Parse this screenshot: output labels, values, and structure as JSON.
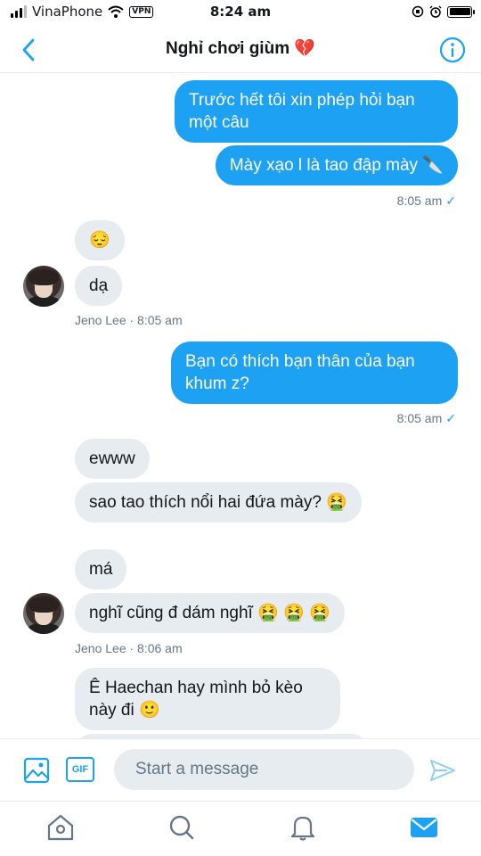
{
  "status_bar": {
    "carrier": "VinaPhone",
    "vpn": "VPN",
    "time": "8:24 am"
  },
  "header": {
    "title": "Nghỉ chơi giùm 💔"
  },
  "messages": [
    {
      "direction": "out",
      "text": "Trước hết tôi xin phép hỏi bạn một câu"
    },
    {
      "direction": "out",
      "text": "Mày xạo l là tao đập mày 🔪"
    },
    {
      "meta": "8:05 am",
      "check": "✓"
    },
    {
      "direction": "in",
      "text": "😔"
    },
    {
      "direction": "in",
      "text": "dạ"
    },
    {
      "meta": "Jeno Lee · 8:05 am"
    },
    {
      "direction": "out",
      "text": "Bạn có thích bạn thân của bạn khum z?"
    },
    {
      "meta": "8:05 am",
      "check": "✓"
    },
    {
      "direction": "in",
      "text": "ewww"
    },
    {
      "direction": "in",
      "text": "sao tao thích nổi hai đứa mày? 🤮"
    },
    {
      "direction": "in",
      "text": "má"
    },
    {
      "direction": "in",
      "text": "nghĩ cũng đ dám nghĩ 🤮 🤮 🤮"
    },
    {
      "meta": "Jeno Lee · 8:06 am"
    },
    {
      "direction": "in",
      "text": "Ê Haechan hay mình bỏ kèo này đi 🙂"
    }
  ],
  "composer": {
    "placeholder": "Start a message",
    "gif_label": "GIF"
  },
  "icons": {
    "back": "chevron-left-icon",
    "info": "info-icon",
    "image": "image-icon",
    "gif": "gif-icon",
    "send": "send-icon",
    "home": "home-icon",
    "search": "search-icon",
    "notifications": "bell-icon",
    "messages": "mail-icon"
  },
  "colors": {
    "accent": "#1da1f2",
    "incoming_bubble": "#e6ecf0",
    "meta_text": "#657786"
  }
}
